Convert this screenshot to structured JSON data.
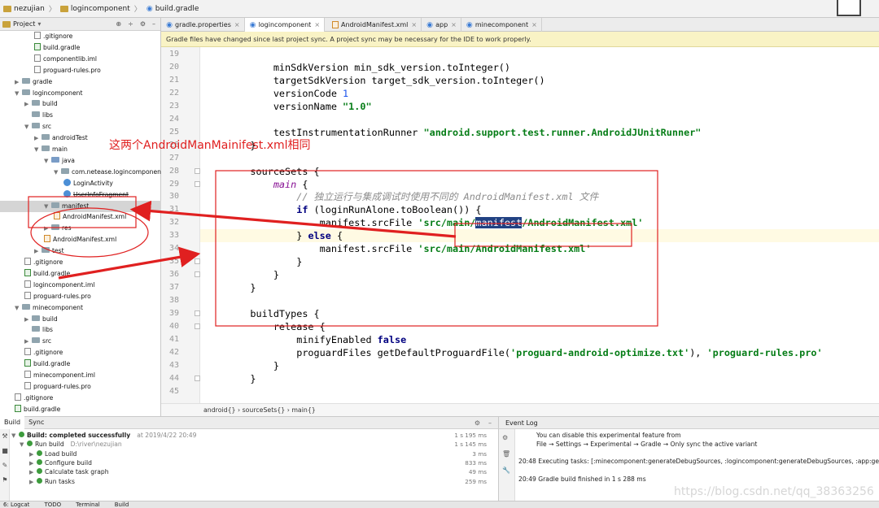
{
  "breadcrumb": [
    "nezujian",
    "logincomponent",
    "build.gradle"
  ],
  "project_panel": {
    "title": "Project",
    "tree": [
      {
        "label": ".gitignore",
        "type": "file",
        "depth": 3
      },
      {
        "label": "build.gradle",
        "type": "gradle",
        "depth": 3
      },
      {
        "label": "componentlib.iml",
        "type": "file",
        "depth": 3
      },
      {
        "label": "proguard-rules.pro",
        "type": "file",
        "depth": 3
      },
      {
        "label": "gradle",
        "type": "folder",
        "depth": 1,
        "arrow": "▶"
      },
      {
        "label": "logincomponent",
        "type": "folder",
        "depth": 1,
        "arrow": "▼"
      },
      {
        "label": "build",
        "type": "folder",
        "depth": 2,
        "arrow": "▶"
      },
      {
        "label": "libs",
        "type": "folder",
        "depth": 2,
        "arrow": ""
      },
      {
        "label": "src",
        "type": "folder",
        "depth": 2,
        "arrow": "▼"
      },
      {
        "label": "androidTest",
        "type": "folder",
        "depth": 3,
        "arrow": "▶"
      },
      {
        "label": "main",
        "type": "folder",
        "depth": 3,
        "arrow": "▼"
      },
      {
        "label": "java",
        "type": "srcfolder",
        "depth": 4,
        "arrow": "▼"
      },
      {
        "label": "com.netease.logincomponent",
        "type": "folder",
        "depth": 5,
        "arrow": "▼"
      },
      {
        "label": "LoginActivity",
        "type": "class",
        "depth": 6
      },
      {
        "label": "UserInfoFragment",
        "type": "class",
        "depth": 6
      },
      {
        "label": "manifest",
        "type": "folder",
        "depth": 4,
        "arrow": "▼",
        "selected": true
      },
      {
        "label": "AndroidManifest.xml",
        "type": "xml",
        "depth": 5
      },
      {
        "label": "res",
        "type": "folder",
        "depth": 4,
        "arrow": "▶"
      },
      {
        "label": "AndroidManifest.xml",
        "type": "xml",
        "depth": 4
      },
      {
        "label": "test",
        "type": "folder",
        "depth": 3,
        "arrow": "▶"
      },
      {
        "label": ".gitignore",
        "type": "file",
        "depth": 2
      },
      {
        "label": "build.gradle",
        "type": "gradle",
        "depth": 2
      },
      {
        "label": "logincomponent.iml",
        "type": "file",
        "depth": 2
      },
      {
        "label": "proguard-rules.pro",
        "type": "file",
        "depth": 2
      },
      {
        "label": "minecomponent",
        "type": "folder",
        "depth": 1,
        "arrow": "▼"
      },
      {
        "label": "build",
        "type": "folder",
        "depth": 2,
        "arrow": "▶"
      },
      {
        "label": "libs",
        "type": "folder",
        "depth": 2,
        "arrow": ""
      },
      {
        "label": "src",
        "type": "folder",
        "depth": 2,
        "arrow": "▶"
      },
      {
        "label": ".gitignore",
        "type": "file",
        "depth": 2
      },
      {
        "label": "build.gradle",
        "type": "gradle",
        "depth": 2
      },
      {
        "label": "minecomponent.iml",
        "type": "file",
        "depth": 2
      },
      {
        "label": "proguard-rules.pro",
        "type": "file",
        "depth": 2
      },
      {
        "label": ".gitignore",
        "type": "file",
        "depth": 1
      },
      {
        "label": "build.gradle",
        "type": "gradle",
        "depth": 1
      }
    ]
  },
  "editor_tabs": [
    {
      "label": "gradle.properties",
      "icon": "gradle-icon"
    },
    {
      "label": "logincomponent",
      "icon": "gradle-icon",
      "active": true
    },
    {
      "label": "AndroidManifest.xml",
      "icon": "xml-icon"
    },
    {
      "label": "app",
      "icon": "gradle-icon"
    },
    {
      "label": "minecomponent",
      "icon": "gradle-icon"
    }
  ],
  "notification": "Gradle files have changed since last project sync. A project sync may be necessary for the IDE to work properly.",
  "code_lines": [
    {
      "n": "19",
      "segs": []
    },
    {
      "n": "20",
      "segs": [
        {
          "t": "        minSdkVersion min_sdk_version.toInteger()"
        }
      ]
    },
    {
      "n": "21",
      "segs": [
        {
          "t": "        targetSdkVersion target_sdk_version.toInteger()"
        }
      ]
    },
    {
      "n": "22",
      "segs": [
        {
          "t": "        versionCode "
        },
        {
          "t": "1",
          "c": "n"
        }
      ]
    },
    {
      "n": "23",
      "segs": [
        {
          "t": "        versionName "
        },
        {
          "t": "\"1.0\"",
          "c": "s"
        }
      ]
    },
    {
      "n": "24",
      "segs": []
    },
    {
      "n": "25",
      "segs": [
        {
          "t": "        testInstrumentationRunner "
        },
        {
          "t": "\"android.support.test.runner.AndroidJUnitRunner\"",
          "c": "s"
        }
      ]
    },
    {
      "n": "26",
      "segs": [
        {
          "t": "    }"
        }
      ]
    },
    {
      "n": "27",
      "segs": []
    },
    {
      "n": "28",
      "segs": [
        {
          "t": "    sourceSets {"
        }
      ]
    },
    {
      "n": "29",
      "segs": [
        {
          "t": "        "
        },
        {
          "t": "main",
          "c": "p"
        },
        {
          "t": " {"
        }
      ]
    },
    {
      "n": "30",
      "segs": [
        {
          "t": "            "
        },
        {
          "t": "// 独立运行与集成调试时使用不同的 AndroidManifest.xml 文件",
          "c": "c"
        }
      ]
    },
    {
      "n": "31",
      "segs": [
        {
          "t": "            "
        },
        {
          "t": "if",
          "c": "k"
        },
        {
          "t": " (loginRunAlone.toBoolean()) {"
        }
      ]
    },
    {
      "n": "32",
      "segs": [
        {
          "t": "                manifest.srcFile "
        },
        {
          "t": "'src/main/",
          "c": "s"
        },
        {
          "t": "manifest",
          "c": "hl"
        },
        {
          "t": "/AndroidManifest.xml'",
          "c": "s"
        }
      ]
    },
    {
      "n": "33",
      "segs": [
        {
          "t": "            } "
        },
        {
          "t": "else",
          "c": "k"
        },
        {
          "t": " {"
        }
      ]
    },
    {
      "n": "34",
      "segs": [
        {
          "t": "                manifest.srcFile "
        },
        {
          "t": "'src/main/AndroidManifest.xml'",
          "c": "s"
        }
      ]
    },
    {
      "n": "35",
      "segs": [
        {
          "t": "            }"
        }
      ]
    },
    {
      "n": "36",
      "segs": [
        {
          "t": "        }"
        }
      ]
    },
    {
      "n": "37",
      "segs": [
        {
          "t": "    }"
        }
      ]
    },
    {
      "n": "38",
      "segs": []
    },
    {
      "n": "39",
      "segs": [
        {
          "t": "    buildTypes {"
        }
      ]
    },
    {
      "n": "40",
      "segs": [
        {
          "t": "        release {"
        }
      ]
    },
    {
      "n": "41",
      "segs": [
        {
          "t": "            minifyEnabled "
        },
        {
          "t": "false",
          "c": "k"
        }
      ]
    },
    {
      "n": "42",
      "segs": [
        {
          "t": "            proguardFiles getDefaultProguardFile("
        },
        {
          "t": "'proguard-android-optimize.txt'",
          "c": "s"
        },
        {
          "t": "), "
        },
        {
          "t": "'proguard-rules.pro'",
          "c": "s"
        }
      ]
    },
    {
      "n": "43",
      "segs": [
        {
          "t": "        }"
        }
      ]
    },
    {
      "n": "44",
      "segs": [
        {
          "t": "    }"
        }
      ]
    },
    {
      "n": "45",
      "segs": []
    }
  ],
  "editor_breadcrumb": "android{}  ›  sourceSets{}  ›  main{}",
  "build_panel": {
    "tabs": [
      "Build",
      "Sync"
    ],
    "rows": [
      {
        "label": "Build: completed successfully",
        "extra": "at 2019/4/22 20:49",
        "time": "1 s 195 ms",
        "bold": true
      },
      {
        "label": "Run build",
        "extra": "D:\\river\\nezujian",
        "time": "1 s 145 ms"
      },
      {
        "label": "Load build",
        "extra": "",
        "time": "3 ms"
      },
      {
        "label": "Configure build",
        "extra": "",
        "time": "833 ms"
      },
      {
        "label": "Calculate task graph",
        "extra": "",
        "time": "49 ms"
      },
      {
        "label": "Run tasks",
        "extra": "",
        "time": "259 ms"
      }
    ]
  },
  "event_log": {
    "title": "Event Log",
    "lines": [
      "You can disable this experimental feature from",
      "File → Settings → Experimental → Gradle → Only sync the active variant",
      "20:48 Executing tasks: [:minecomponent:generateDebugSources, :logincomponent:generateDebugSources, :app:gen",
      "20:49 Gradle build finished in 1 s 288 ms"
    ]
  },
  "bottom_tabs": [
    "6: Logcat",
    "TODO",
    "Terminal",
    "Build"
  ],
  "annotation": "这两个AndroidManMainifest.xml相同",
  "watermark": "https://blog.csdn.net/qq_38363256",
  "colors": {
    "annotation": "#e02020",
    "string": "#067d17",
    "keyword": "#000080",
    "number": "#1750eb"
  }
}
